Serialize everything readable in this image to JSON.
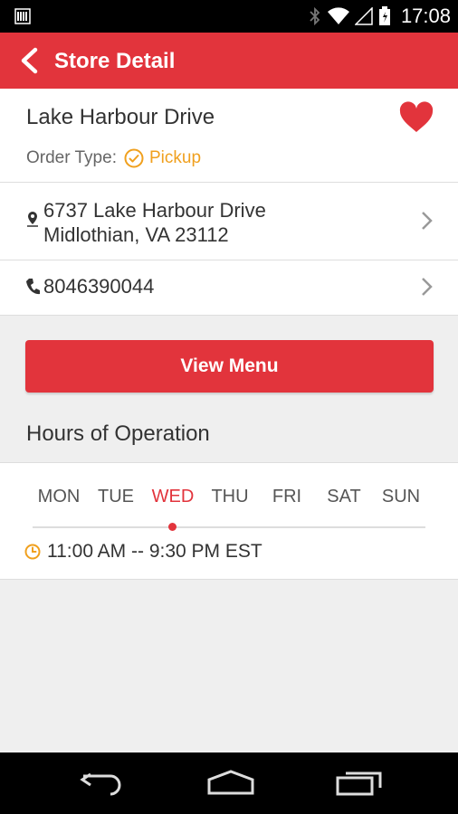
{
  "status_bar": {
    "time": "17:08"
  },
  "header": {
    "title": "Store Detail"
  },
  "store": {
    "name": "Lake Harbour Drive",
    "order_type_label": "Order Type:",
    "order_type_value": "Pickup",
    "address_line1": "6737 Lake Harbour Drive",
    "address_line2": "Midlothian, VA 23112",
    "phone": "8046390044"
  },
  "view_menu_label": "View Menu",
  "hours": {
    "heading": "Hours of Operation",
    "days": [
      "MON",
      "TUE",
      "WED",
      "THU",
      "FRI",
      "SAT",
      "SUN"
    ],
    "selected_day": "WED",
    "time_range": "11:00 AM -- 9:30 PM EST"
  },
  "colors": {
    "accent": "#e2343c",
    "pickup": "#f0a01e"
  },
  "icons": [
    "back-arrow-icon",
    "heart-icon",
    "check-circle-icon",
    "location-pin-icon",
    "phone-icon",
    "chevron-right-icon",
    "clock-icon",
    "nav-back-icon",
    "nav-home-icon",
    "nav-recents-icon"
  ]
}
